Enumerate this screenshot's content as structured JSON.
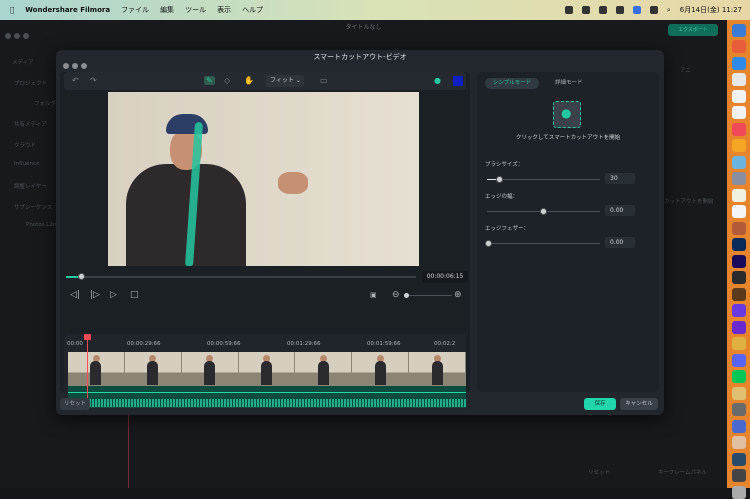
{
  "menubar": {
    "app": "Wondershare Filmora",
    "items": [
      "ファイル",
      "編集",
      "ツール",
      "表示",
      "ヘルプ"
    ],
    "datetime": "6月14日(金) 11:27"
  },
  "app": {
    "title": "タイトルなし",
    "export": "エクスポート",
    "sidebar": [
      "メディア",
      "プロジェクト",
      "フォルダ",
      "共有メディア",
      "クラウド",
      "Influence",
      "調整レイヤー",
      "サブシーケンス",
      "Photos Library"
    ],
    "right_hint": "カットアウトを開始",
    "reset": "リセット",
    "keyframe": "キーフレームパネル",
    "tab": "アニ"
  },
  "dialog": {
    "title": "スマートカットアウト-ビデオ",
    "toolbar": {
      "fit": "フィット"
    },
    "timecode": "00:00:06:15",
    "seek_progress": 0.04,
    "ruler": [
      "00:00",
      "00:00:29:66",
      "00:00:59:66",
      "00:01:29:66",
      "00:01:59:66",
      "00:02:2"
    ],
    "reset": "リセット",
    "modes": [
      "シンプルモード",
      "詳細モード"
    ],
    "cut_hint": "クリックしてスマートカットアウトを開始",
    "sliders": [
      {
        "label": "ブラシサイズ：",
        "value": "30",
        "fraction": 0.1
      },
      {
        "label": "エッジの幅：",
        "value": "0.00",
        "fraction": 0.5
      },
      {
        "label": "エッジフェザー：",
        "value": "0.00",
        "fraction": 0
      }
    ],
    "save": "保存",
    "cancel": "キャンセル"
  },
  "dock_colors": [
    "#3a7bd5",
    "#e85d3a",
    "#2e8ae6",
    "#e8e8e8",
    "#f2f2f2",
    "#f2f2f2",
    "#f04a5a",
    "#f5a623",
    "#6bb3e0",
    "#8a8fa0",
    "#f2f0e0",
    "#f5f5f5",
    "#b25a3a",
    "#0a2a5a",
    "#1a0a5a",
    "#2b2b2b",
    "#5a3a1a",
    "#6a3ae0",
    "#6a2ad0",
    "#e0b040",
    "#5865f2",
    "#06c755",
    "#e0c070",
    "#6a6a6a",
    "#4a6ad0",
    "#e0c0a0",
    "#2a4a6a",
    "#444",
    "#aaa"
  ]
}
